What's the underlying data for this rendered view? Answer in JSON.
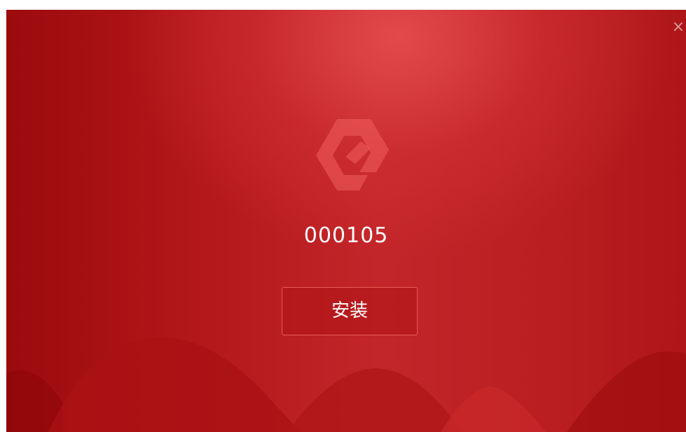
{
  "window": {
    "close_glyph": "×",
    "logo_icon": "hexagon-e-logo-icon",
    "version_text": "000105",
    "install_label": "安装"
  },
  "colors": {
    "background_red": "#b81c1f",
    "accent_light_red": "#e04a4c",
    "text": "#ffffff"
  }
}
